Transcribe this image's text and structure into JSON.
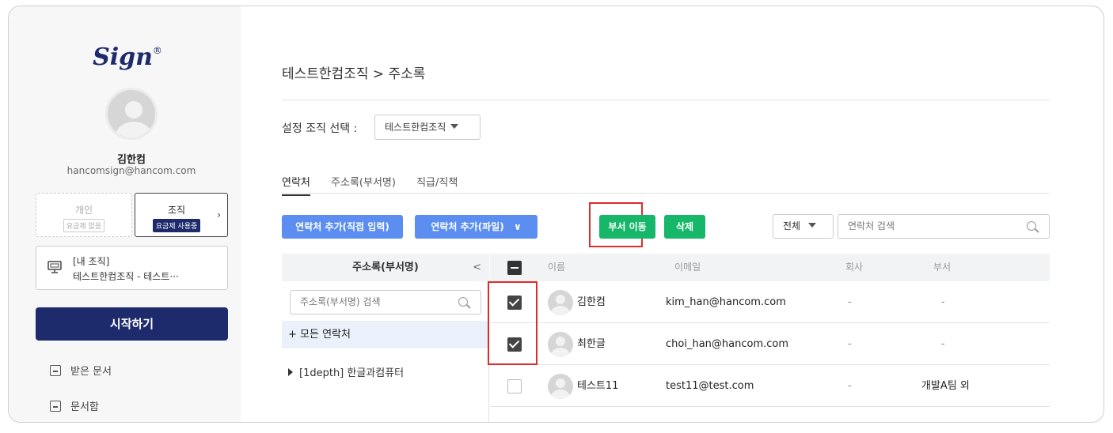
{
  "sidebar": {
    "logo": "Sign",
    "logo_mark": "®",
    "user_name": "김한컴",
    "user_email": "hancomsign@hancom.com",
    "plan_personal": {
      "label": "개인",
      "badge": "요금제 없음"
    },
    "plan_org": {
      "label": "조직",
      "badge": "요금제 사용중",
      "chevron": "›"
    },
    "org_box": {
      "line1": "[내 조직]",
      "line2": "테스트한컴조직 - 테스트···"
    },
    "start_label": "시작하기",
    "menu": [
      {
        "label": "받은 문서",
        "icon": "inbox-icon"
      },
      {
        "label": "문서함",
        "icon": "document-box-icon"
      }
    ]
  },
  "main": {
    "breadcrumb": "테스트한컴조직 > 주소록",
    "org_select_label": "설정 조직 선택 :",
    "org_select_value": "테스트한컴조직",
    "tabs": [
      "연락처",
      "주소록(부서명)",
      "직급/직책"
    ],
    "toolbar": {
      "add_direct": "연락처 추가(직접 입력)",
      "add_file": "연락처 추가(파일)",
      "add_file_caret": "∨",
      "move_dept": "부서 이동",
      "delete": "삭제",
      "filter_value": "전체",
      "search_placeholder": "연락처 검색"
    },
    "tree": {
      "header": "주소록(부서명)",
      "collapse": "<",
      "search_placeholder": "주소록(부서명) 검색",
      "all_contacts": "+ 모든 연락처",
      "node": "[1depth] 한글과컴퓨터"
    },
    "table": {
      "headers": {
        "name": "이름",
        "email": "이메일",
        "company": "회사",
        "dept": "부서"
      },
      "rows": [
        {
          "checked": true,
          "name": "김한컴",
          "email": "kim_han@hancom.com",
          "company": "-",
          "dept": "-"
        },
        {
          "checked": true,
          "name": "최한글",
          "email": "choi_han@hancom.com",
          "company": "-",
          "dept": "-"
        },
        {
          "checked": false,
          "name": "테스트11",
          "email": "test11@test.com",
          "company": "-",
          "dept": "개발A팀 외"
        }
      ]
    }
  },
  "colors": {
    "brand_navy": "#1d2a6b",
    "blue_button": "#5b8ef0",
    "green_button": "#17b769",
    "highlight_red": "#e02b2b"
  }
}
